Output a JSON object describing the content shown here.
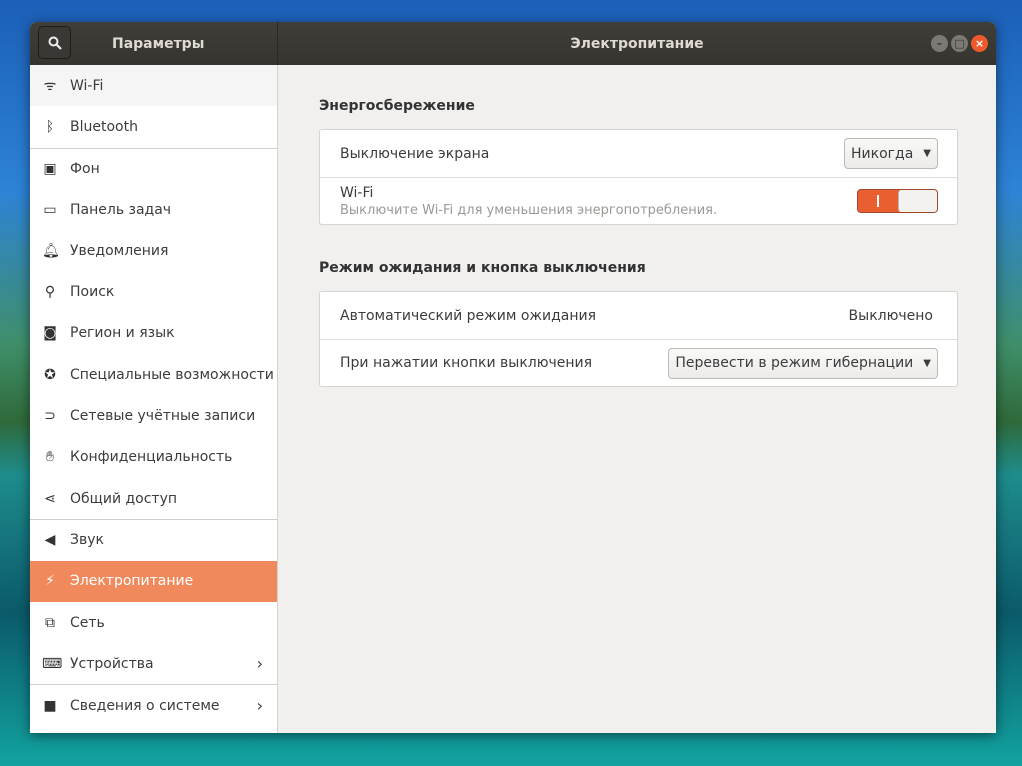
{
  "window": {
    "sidebar_title": "Параметры",
    "page_title": "Электропитание"
  },
  "sidebar": {
    "items": [
      {
        "label": "Wi-Fi",
        "icon": "wifi-icon"
      },
      {
        "label": "Bluetooth",
        "icon": "bluetooth-icon"
      },
      {
        "label": "Фон",
        "icon": "background-icon"
      },
      {
        "label": "Панель задач",
        "icon": "dock-icon"
      },
      {
        "label": "Уведомления",
        "icon": "bell-icon"
      },
      {
        "label": "Поиск",
        "icon": "search-icon"
      },
      {
        "label": "Регион и язык",
        "icon": "region-icon"
      },
      {
        "label": "Специальные возможности",
        "icon": "accessibility-icon"
      },
      {
        "label": "Сетевые учётные записи",
        "icon": "online-accounts-icon"
      },
      {
        "label": "Конфиденциальность",
        "icon": "hand-icon"
      },
      {
        "label": "Общий доступ",
        "icon": "share-icon"
      },
      {
        "label": "Звук",
        "icon": "speaker-icon"
      },
      {
        "label": "Электропитание",
        "icon": "power-icon"
      },
      {
        "label": "Сеть",
        "icon": "network-icon"
      },
      {
        "label": "Устройства",
        "icon": "devices-icon"
      },
      {
        "label": "Сведения о системе",
        "icon": "info-icon"
      }
    ]
  },
  "power_saving": {
    "heading": "Энергосбережение",
    "blank_screen_label": "Выключение экрана",
    "blank_screen_value": "Никогда",
    "wifi_label": "Wi-Fi",
    "wifi_sub": "Выключите Wi-Fi для уменьшения энергопотребления.",
    "wifi_on": true
  },
  "suspend": {
    "heading": "Режим ожидания и кнопка выключения",
    "auto_label": "Автоматический режим ожидания",
    "auto_value": "Выключено",
    "button_label": "При нажатии кнопки выключения",
    "button_value": "Перевести в режим гибернации"
  },
  "colors": {
    "accent": "#f08a5d",
    "switch": "#e95f2f"
  }
}
